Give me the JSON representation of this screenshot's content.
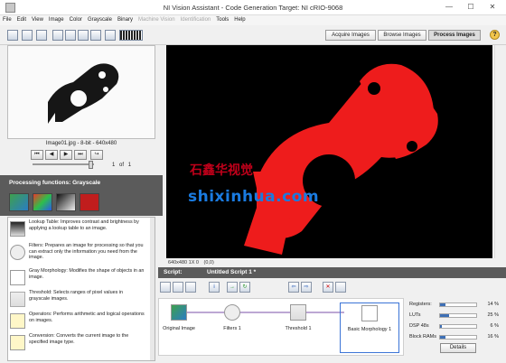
{
  "window": {
    "title": "NI Vision Assistant - Code Generation Target: NI cRIO-9068",
    "minimize": "—",
    "maximize": "☐",
    "close": "✕"
  },
  "menu": [
    "File",
    "Edit",
    "View",
    "Image",
    "Color",
    "Grayscale",
    "Binary",
    "Machine Vision",
    "Identification",
    "Tools",
    "Help"
  ],
  "menu_disabled": [
    "Machine Vision",
    "Identification"
  ],
  "view_tabs": {
    "acquire": "Acquire Images",
    "browse": "Browse Images",
    "process": "Process Images"
  },
  "help_label": "?",
  "image_browser": {
    "info": "Image01.jpg - 8-bit - 640x480",
    "nav": [
      "⏮",
      "◀",
      "▶",
      "⏭",
      "↪"
    ],
    "page_current": "1",
    "page_of": "of",
    "page_total": "1"
  },
  "processing": {
    "header": "Processing functions: Grayscale",
    "functions": [
      {
        "name": "Lookup Table:",
        "desc": "Improves contrast and brightness by applying a lookup table to an image."
      },
      {
        "name": "Filters:",
        "desc": "Prepares an image for processing so that you can extract only the information you need from the image."
      },
      {
        "name": "Gray Morphology:",
        "desc": "Modifies the shape of objects in an image."
      },
      {
        "name": "Threshold:",
        "desc": "Selects ranges of pixel values in grayscale images."
      },
      {
        "name": "Operators:",
        "desc": "Performs arithmetic and logical operations on images."
      },
      {
        "name": "Conversion:",
        "desc": "Converts the current image to the specified image type."
      }
    ]
  },
  "status": {
    "size": "640x480 1X 0",
    "coords": "(0,0)"
  },
  "script": {
    "label": "Script:",
    "name": "Untitled Script 1 *",
    "steps": [
      "Original Image",
      "Filters 1",
      "Threshold 1",
      "Basic Morphology 1"
    ]
  },
  "resources": [
    {
      "name": "Registers:",
      "value": 14,
      "pct": "14",
      "unit": "%"
    },
    {
      "name": "LUTs",
      "value": 25,
      "pct": "25",
      "unit": "%"
    },
    {
      "name": "DSP 48s",
      "value": 6,
      "pct": "6",
      "unit": "%"
    },
    {
      "name": "Block RAMs",
      "value": 16,
      "pct": "16",
      "unit": "%"
    }
  ],
  "details_label": "Details",
  "watermark": {
    "cn": "石鑫华视觉",
    "url": "shixinhua.com"
  },
  "colors": {
    "accent": "#ee1c1c",
    "panel_header": "#5b5b5b",
    "bar": "#3d6fb5"
  }
}
